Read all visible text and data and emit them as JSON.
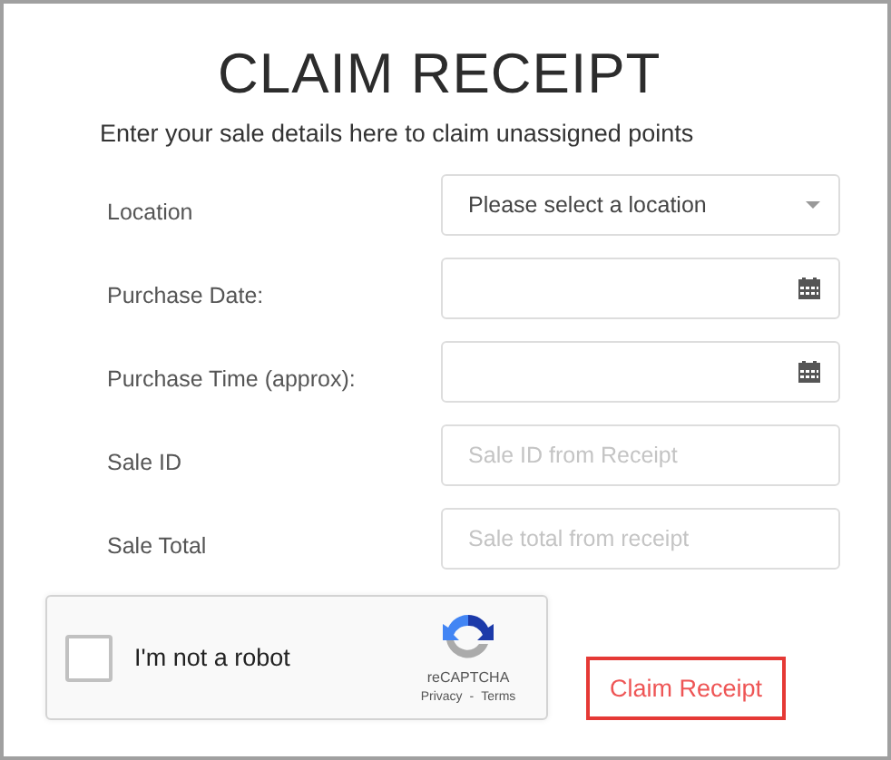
{
  "title": "CLAIM RECEIPT",
  "subtitle": "Enter your sale details here to claim unassigned points",
  "fields": [
    {
      "label": "Location",
      "kind": "select",
      "value": "Please select a location"
    },
    {
      "label": "Purchase Date:",
      "kind": "date"
    },
    {
      "label": "Purchase Time (approx):",
      "kind": "date"
    },
    {
      "label": "Sale ID",
      "kind": "text",
      "placeholder": "Sale ID from Receipt"
    },
    {
      "label": "Sale Total",
      "kind": "text",
      "placeholder": "Sale total from receipt"
    }
  ],
  "captcha": {
    "label": "I'm not a robot",
    "checked": false,
    "brand": "reCAPTCHA",
    "privacy": "Privacy",
    "separator": "-",
    "terms": "Terms"
  },
  "submit": "Claim Receipt"
}
